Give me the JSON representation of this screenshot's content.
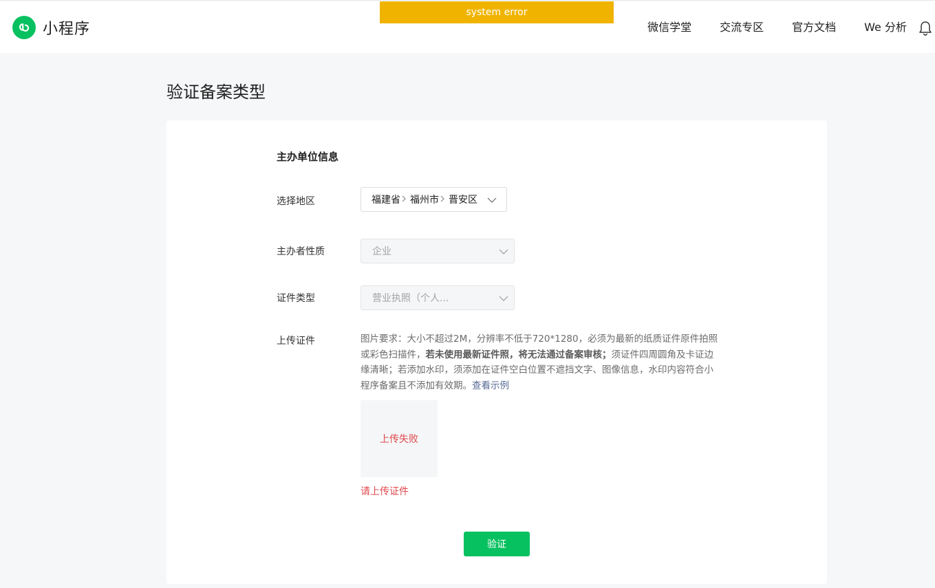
{
  "header": {
    "brand_title": "小程序",
    "error_banner": "system error",
    "nav": [
      {
        "label": "微信学堂"
      },
      {
        "label": "交流专区"
      },
      {
        "label": "官方文档"
      },
      {
        "label": "We 分析"
      }
    ]
  },
  "page": {
    "title": "验证备案类型"
  },
  "form": {
    "section_title": "主办单位信息",
    "region": {
      "label": "选择地区",
      "province": "福建省",
      "city": "福州市",
      "district": "晋安区"
    },
    "sponsor_type": {
      "label": "主办者性质",
      "value": "企业"
    },
    "certificate_type": {
      "label": "证件类型",
      "value": "营业执照（个人..."
    },
    "upload": {
      "label": "上传证件",
      "req_part1": "图片要求：大小不超过2M，分辨率不低于720*1280，必须为最新的纸质证件原件拍照或彩色扫描件，",
      "req_bold": "若未使用最新证件照，将无法通过备案审核；",
      "req_part2": "须证件四周圆角及卡证边缘清晰；若添加水印，须添加在证件空白位置不遮挡文字、图像信息，水印内容符合小程序备案且不添加有效期。",
      "view_example": "查看示例",
      "status": "上传失败",
      "error_hint": "请上传证件"
    },
    "submit_label": "验证"
  },
  "colors": {
    "brand_green": "#07c160",
    "banner_yellow": "#f0b400",
    "error_red": "#e0474c",
    "link_blue": "#576b95"
  }
}
